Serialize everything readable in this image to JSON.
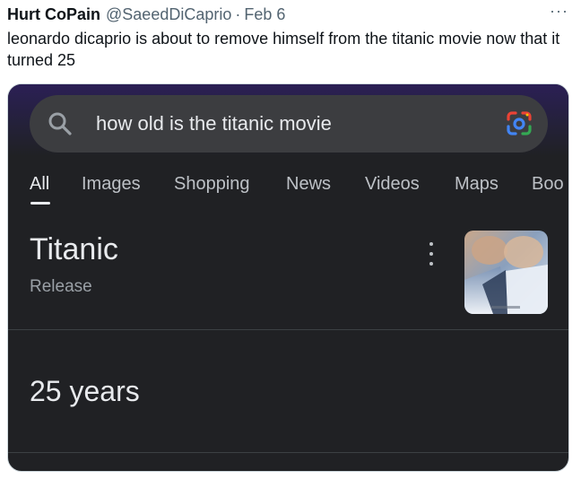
{
  "tweet": {
    "author_name": "Hurt CoPain",
    "author_handle": "@SaeedDiCaprio",
    "separator": "·",
    "date": "Feb 6",
    "more": "···",
    "text": "leonardo dicaprio is about to remove himself from the titanic movie now that it turned 25"
  },
  "search": {
    "query": "how old is the titanic movie"
  },
  "tabs": [
    {
      "label": "All",
      "active": true
    },
    {
      "label": "Images"
    },
    {
      "label": "Shopping"
    },
    {
      "label": "News"
    },
    {
      "label": "Videos"
    },
    {
      "label": "Maps"
    },
    {
      "label": "Boo"
    }
  ],
  "result": {
    "title": "Titanic",
    "subtitle": "Release",
    "answer": "25 years"
  },
  "colors": {
    "background": "#202124",
    "search_bar": "#3c3d40",
    "text_primary": "#e8eaed",
    "text_secondary": "#9aa0a6"
  },
  "icons": {
    "search": "search-icon",
    "lens": "google-lens-icon",
    "more": "more-horizontal-icon",
    "kebab": "kebab-menu-icon"
  }
}
